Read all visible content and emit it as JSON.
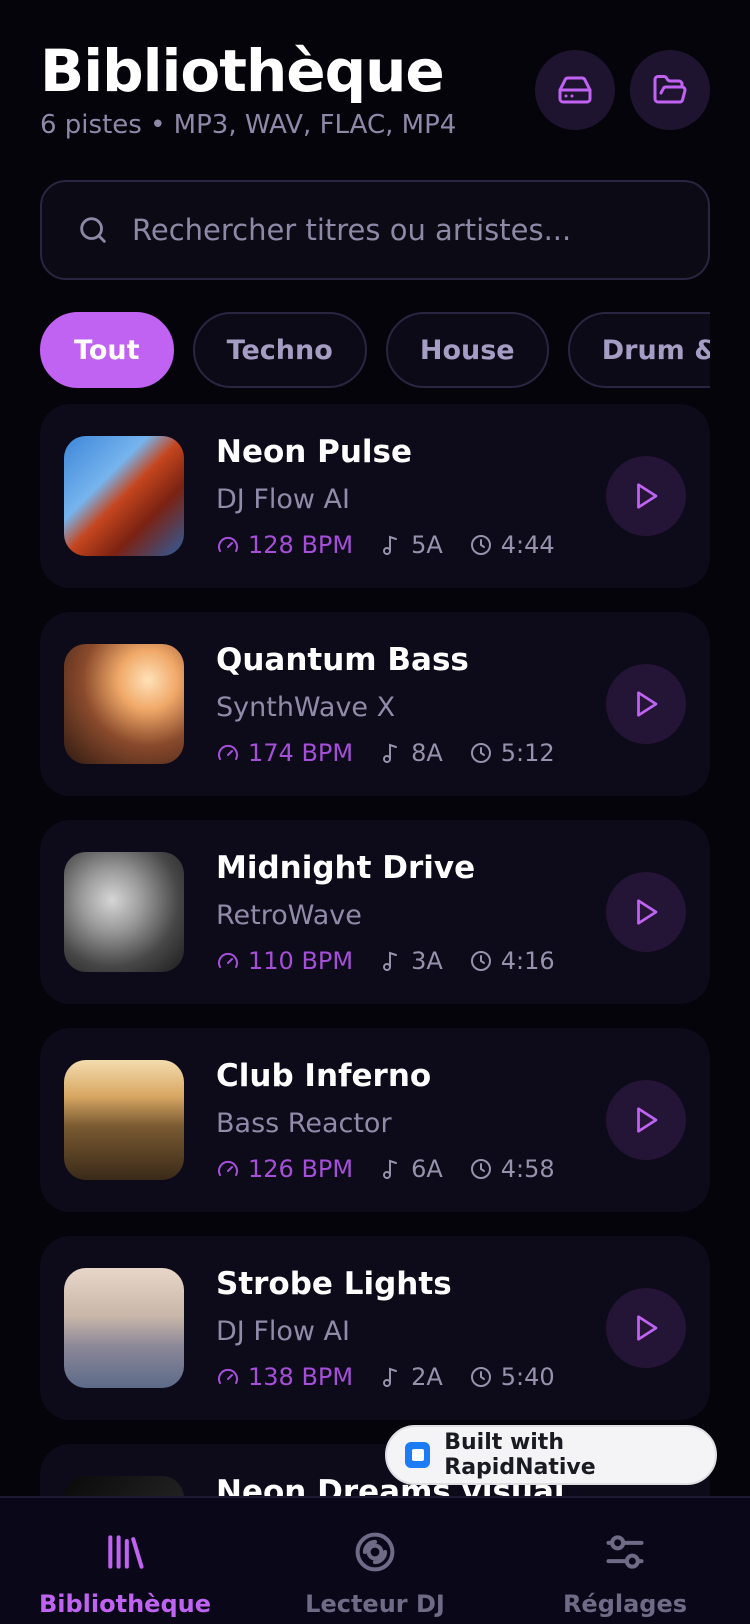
{
  "header": {
    "title": "Bibliothèque",
    "subtitle": "6 pistes • MP3, WAV, FLAC, MP4",
    "drive_icon": "hard-drive-icon",
    "folder_icon": "folder-open-icon"
  },
  "search": {
    "placeholder": "Rechercher titres ou artistes...",
    "value": ""
  },
  "filters": [
    "Tout",
    "Techno",
    "House",
    "Drum & Bass"
  ],
  "active_filter": "Tout",
  "tracks": [
    {
      "title": "Neon Pulse",
      "artist": "DJ Flow AI",
      "bpm": "128 BPM",
      "key": "5A",
      "duration": "4:44"
    },
    {
      "title": "Quantum Bass",
      "artist": "SynthWave X",
      "bpm": "174 BPM",
      "key": "8A",
      "duration": "5:12"
    },
    {
      "title": "Midnight Drive",
      "artist": "RetroWave",
      "bpm": "110 BPM",
      "key": "3A",
      "duration": "4:16"
    },
    {
      "title": "Club Inferno",
      "artist": "Bass Reactor",
      "bpm": "126 BPM",
      "key": "6A",
      "duration": "4:58"
    },
    {
      "title": "Strobe Lights",
      "artist": "DJ Flow AI",
      "bpm": "138 BPM",
      "key": "2A",
      "duration": "5:40"
    },
    {
      "title": "Neon Dreams visual",
      "artist": "",
      "bpm": "",
      "key": "",
      "duration": ""
    }
  ],
  "badge": {
    "label": "Built with RapidNative"
  },
  "nav": {
    "items": [
      {
        "label": "Bibliothèque",
        "icon": "library-icon",
        "active": true
      },
      {
        "label": "Lecteur DJ",
        "icon": "disc-icon",
        "active": false
      },
      {
        "label": "Réglages",
        "icon": "sliders-icon",
        "active": false
      }
    ]
  },
  "colors": {
    "background": "#05040b",
    "card": "#0d0a19",
    "accent": "#c062f2",
    "bpm": "#a54fd8",
    "muted": "#918aa9"
  }
}
